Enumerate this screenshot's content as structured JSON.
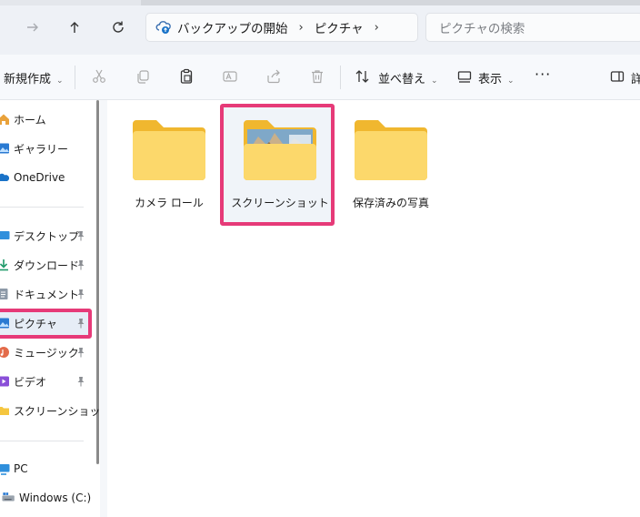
{
  "address": {
    "crumbs": [
      "バックアップの開始",
      "ピクチャ"
    ]
  },
  "search": {
    "placeholder": "ピクチャの検索"
  },
  "toolbar": {
    "new_label": "新規作成",
    "sort_label": "並べ替え",
    "view_label": "表示",
    "more_label": "···",
    "details_label": "詳"
  },
  "sidebar": {
    "items": [
      {
        "label": "ホーム",
        "icon": "home-icon"
      },
      {
        "label": "ギャラリー",
        "icon": "gallery-icon"
      },
      {
        "label": "OneDrive",
        "icon": "onedrive-icon"
      },
      {
        "label": "デスクトップ",
        "icon": "desktop-icon",
        "pinned": true
      },
      {
        "label": "ダウンロード",
        "icon": "download-icon",
        "pinned": true
      },
      {
        "label": "ドキュメント",
        "icon": "document-icon",
        "pinned": true
      },
      {
        "label": "ピクチャ",
        "icon": "pictures-icon",
        "pinned": true,
        "selected": true
      },
      {
        "label": "ミュージック",
        "icon": "music-icon",
        "pinned": true
      },
      {
        "label": "ビデオ",
        "icon": "video-icon",
        "pinned": true
      },
      {
        "label": "スクリーンショット",
        "icon": "folder-icon"
      },
      {
        "label": "PC",
        "icon": "pc-icon"
      },
      {
        "label": "Windows (C:)",
        "icon": "drive-icon"
      }
    ]
  },
  "folders": [
    {
      "label": "カメラ ロール",
      "thumbnail": false
    },
    {
      "label": "スクリーンショット",
      "thumbnail": true,
      "highlighted": true
    },
    {
      "label": "保存済みの写真",
      "thumbnail": false
    }
  ],
  "colors": {
    "highlight": "#e63a78",
    "folder": "#f5c63f",
    "folder_front": "#fcd86b",
    "accent": "#1a73c8"
  }
}
